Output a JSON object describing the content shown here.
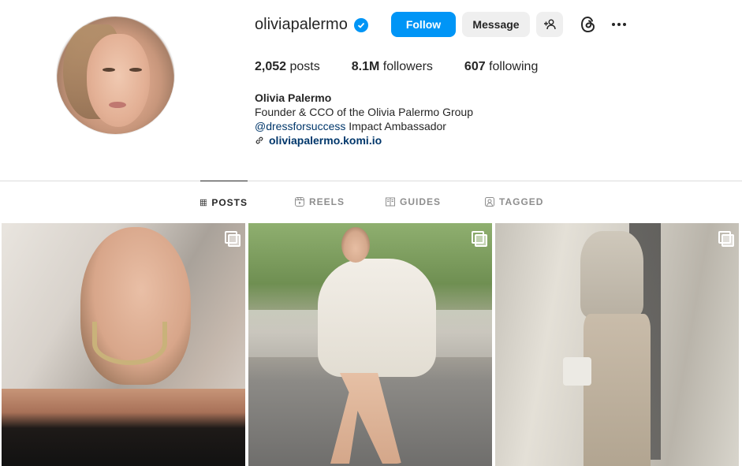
{
  "profile": {
    "username": "oliviapalermo",
    "verified": true,
    "follow_label": "Follow",
    "message_label": "Message"
  },
  "stats": {
    "posts_count": "2,052",
    "posts_label": "posts",
    "followers_count": "8.1M",
    "followers_label": "followers",
    "following_count": "607",
    "following_label": "following"
  },
  "bio": {
    "name": "Olivia Palermo",
    "line1": "Founder & CCO of the Olivia Palermo Group",
    "mention": "@dressforsuccess",
    "line2_rest": " Impact Ambassador",
    "link": "oliviapalermo.komi.io"
  },
  "tabs": [
    {
      "label": "POSTS",
      "icon": "grid-icon",
      "active": true
    },
    {
      "label": "REELS",
      "icon": "reels-icon",
      "active": false
    },
    {
      "label": "GUIDES",
      "icon": "guides-icon",
      "active": false
    },
    {
      "label": "TAGGED",
      "icon": "tagged-icon",
      "active": false
    }
  ],
  "posts": [
    {
      "type": "carousel",
      "icon": "multi-post-icon"
    },
    {
      "type": "carousel",
      "icon": "multi-post-icon"
    },
    {
      "type": "carousel",
      "icon": "multi-post-icon"
    }
  ],
  "colors": {
    "accent": "#0095f6",
    "text": "#262626",
    "muted": "#8e8e8e",
    "link": "#00376b",
    "button_bg": "#efefef",
    "divider": "#dbdbdb"
  }
}
